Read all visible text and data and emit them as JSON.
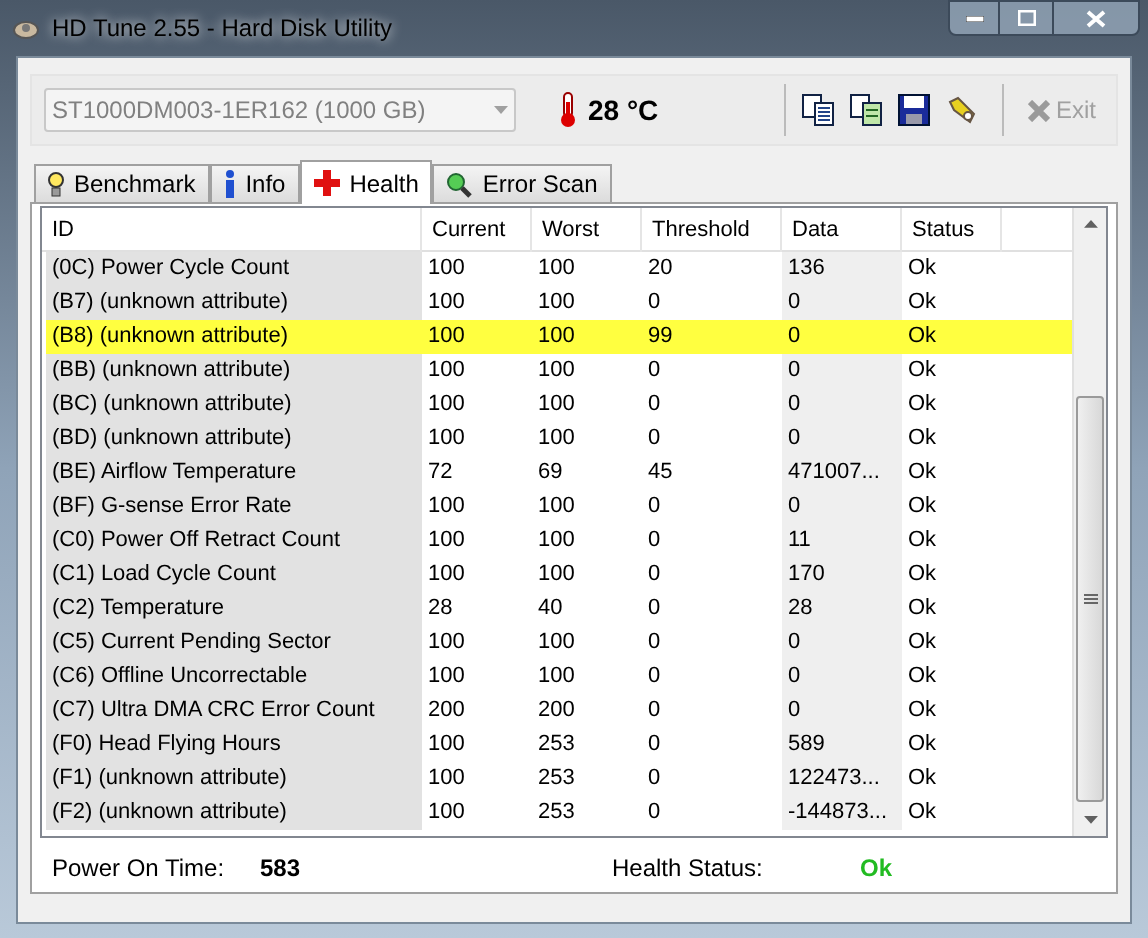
{
  "window": {
    "title": "HD Tune 2.55 - Hard Disk Utility"
  },
  "toolbar": {
    "drive": "ST1000DM003-1ER162 (1000 GB)",
    "temperature": "28 °C",
    "exit": {
      "label": "Exit",
      "disabled": true
    }
  },
  "tabs": [
    {
      "label": "Benchmark",
      "kind": "bulb",
      "selected": false
    },
    {
      "label": "Info",
      "kind": "info",
      "selected": false
    },
    {
      "label": "Health",
      "kind": "cross",
      "selected": true
    },
    {
      "label": "Error Scan",
      "kind": "magnifier",
      "selected": false
    }
  ],
  "table": {
    "columns": [
      "ID",
      "Current",
      "Worst",
      "Threshold",
      "Data",
      "Status"
    ],
    "rows": [
      {
        "cells": [
          "(0C) Power Cycle Count",
          "100",
          "100",
          "20",
          "136",
          "Ok"
        ],
        "highlighted": false
      },
      {
        "cells": [
          "(B7) (unknown attribute)",
          "100",
          "100",
          "0",
          "0",
          "Ok"
        ],
        "highlighted": false
      },
      {
        "cells": [
          "(B8) (unknown attribute)",
          "100",
          "100",
          "99",
          "0",
          "Ok"
        ],
        "highlighted": true
      },
      {
        "cells": [
          "(BB) (unknown attribute)",
          "100",
          "100",
          "0",
          "0",
          "Ok"
        ],
        "highlighted": false
      },
      {
        "cells": [
          "(BC) (unknown attribute)",
          "100",
          "100",
          "0",
          "0",
          "Ok"
        ],
        "highlighted": false
      },
      {
        "cells": [
          "(BD) (unknown attribute)",
          "100",
          "100",
          "0",
          "0",
          "Ok"
        ],
        "highlighted": false
      },
      {
        "cells": [
          "(BE) Airflow Temperature",
          "72",
          "69",
          "45",
          "471007...",
          "Ok"
        ],
        "highlighted": false
      },
      {
        "cells": [
          "(BF) G-sense Error Rate",
          "100",
          "100",
          "0",
          "0",
          "Ok"
        ],
        "highlighted": false
      },
      {
        "cells": [
          "(C0) Power Off Retract Count",
          "100",
          "100",
          "0",
          "11",
          "Ok"
        ],
        "highlighted": false
      },
      {
        "cells": [
          "(C1) Load Cycle Count",
          "100",
          "100",
          "0",
          "170",
          "Ok"
        ],
        "highlighted": false
      },
      {
        "cells": [
          "(C2) Temperature",
          "28",
          "40",
          "0",
          "28",
          "Ok"
        ],
        "highlighted": false
      },
      {
        "cells": [
          "(C5) Current Pending Sector",
          "100",
          "100",
          "0",
          "0",
          "Ok"
        ],
        "highlighted": false
      },
      {
        "cells": [
          "(C6) Offline Uncorrectable",
          "100",
          "100",
          "0",
          "0",
          "Ok"
        ],
        "highlighted": false
      },
      {
        "cells": [
          "(C7) Ultra DMA CRC Error Count",
          "200",
          "200",
          "0",
          "0",
          "Ok"
        ],
        "highlighted": false
      },
      {
        "cells": [
          "(F0) Head Flying Hours",
          "100",
          "253",
          "0",
          "589",
          "Ok"
        ],
        "highlighted": false
      },
      {
        "cells": [
          "(F1) (unknown attribute)",
          "100",
          "253",
          "0",
          "122473...",
          "Ok"
        ],
        "highlighted": false
      },
      {
        "cells": [
          "(F2) (unknown attribute)",
          "100",
          "253",
          "0",
          "-144873...",
          "Ok"
        ],
        "highlighted": false
      }
    ]
  },
  "footer": {
    "power_on_label": "Power On Time:",
    "power_on_value": "583",
    "health_label": "Health Status:",
    "health_value": "Ok"
  }
}
